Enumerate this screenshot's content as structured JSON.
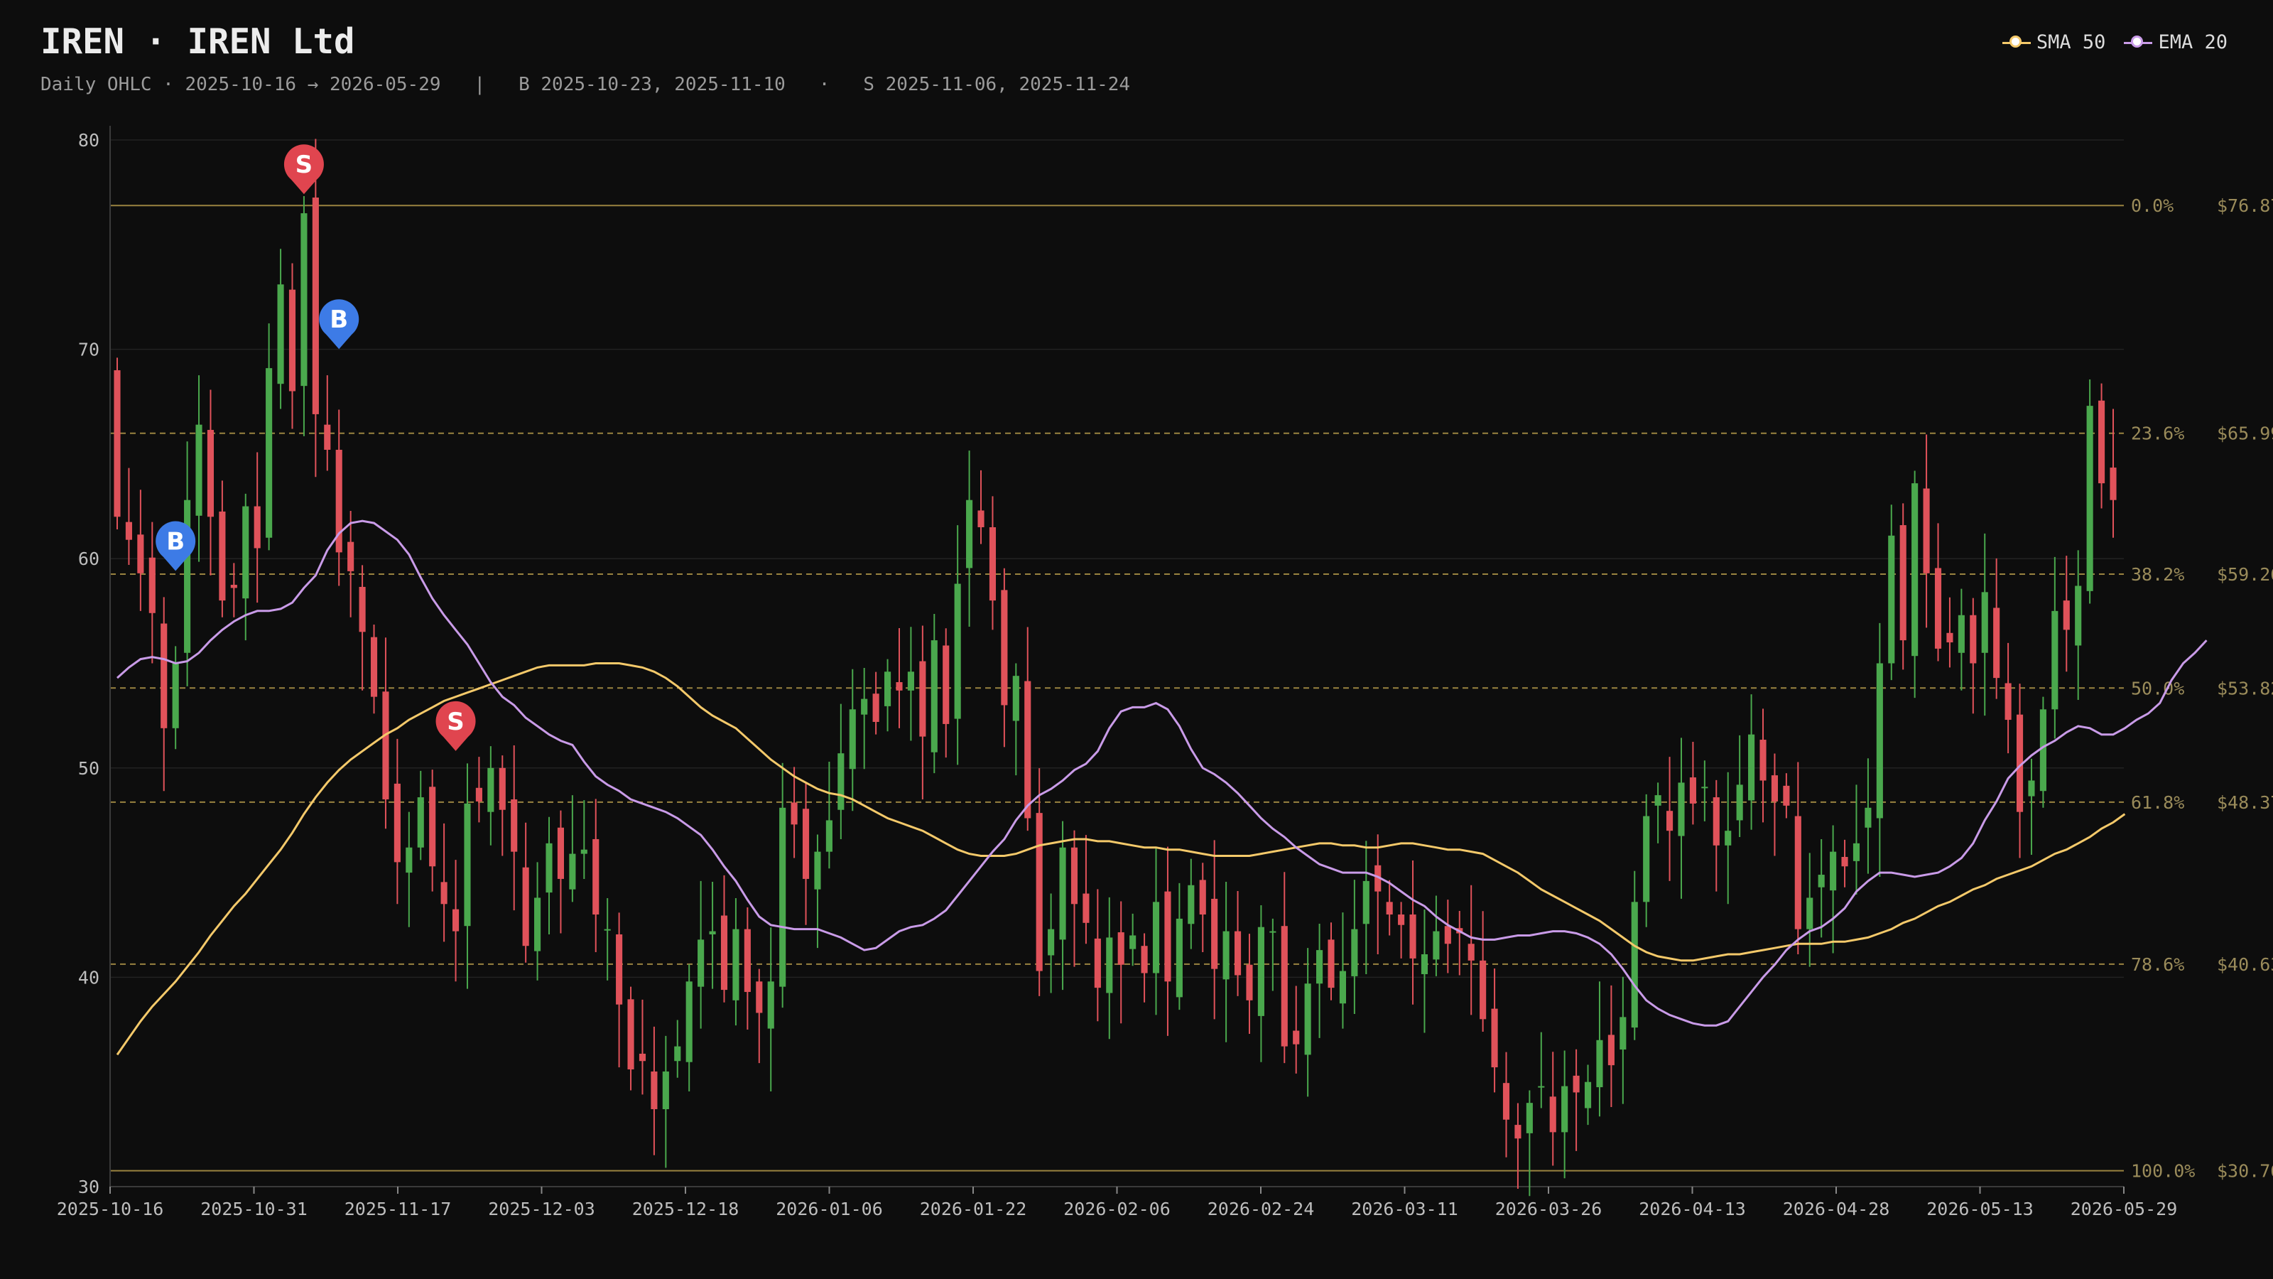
{
  "header": {
    "title": "IREN · IREN Ltd",
    "subtitle": "Daily OHLC · 2025-10-16 → 2026-05-29   |   B 2025-10-23, 2025-11-10   ·   S 2025-11-06, 2025-11-24"
  },
  "legend": [
    {
      "name": "SMA 50",
      "color": "#f4c96a"
    },
    {
      "name": "EMA 20",
      "color": "#c99be8"
    }
  ],
  "colors": {
    "up": "#4aa84d",
    "down": "#e0525a",
    "fib": "#9a8340",
    "fib_label": "#9a8b5a",
    "grid": "#222222",
    "axis_text": "#bdbdbd",
    "buy_marker": "#3d7be6",
    "sell_marker": "#e0454f"
  },
  "chart_data": {
    "type": "candlestick",
    "ylim": [
      30,
      80
    ],
    "y_ticks": [
      30,
      40,
      50,
      60,
      70,
      80
    ],
    "x_range": [
      "2025-10-16",
      "2026-05-29"
    ],
    "x_tick_labels": [
      "2025-10-16",
      "2025-10-31",
      "2025-11-17",
      "2025-12-03",
      "2025-12-18",
      "2026-01-06",
      "2026-01-22",
      "2026-02-06",
      "2026-02-24",
      "2026-03-11",
      "2026-03-26",
      "2026-04-13",
      "2026-04-28",
      "2026-05-13",
      "2026-05-29"
    ],
    "fibonacci": [
      {
        "level": "0.0%",
        "price": 76.87,
        "label": "$76.87"
      },
      {
        "level": "23.6%",
        "price": 65.99,
        "label": "$65.99"
      },
      {
        "level": "38.2%",
        "price": 59.26,
        "label": "$59.26"
      },
      {
        "level": "50.0%",
        "price": 53.82,
        "label": "$53.82"
      },
      {
        "level": "61.8%",
        "price": 48.37,
        "label": "$48.37"
      },
      {
        "level": "78.6%",
        "price": 40.63,
        "label": "$40.63"
      },
      {
        "level": "100.0%",
        "price": 30.76,
        "label": "$30.76"
      }
    ],
    "markers": [
      {
        "type": "B",
        "index": 5,
        "price": 60.6
      },
      {
        "type": "S",
        "index": 16,
        "price": 78.6
      },
      {
        "type": "B",
        "index": 19,
        "price": 71.2
      },
      {
        "type": "S",
        "index": 29,
        "price": 52.0
      }
    ],
    "closes": [
      62.0,
      60.9,
      59.3,
      57.4,
      51.9,
      55.0,
      62.8,
      66.4,
      62.0,
      58.0,
      58.6,
      62.5,
      60.5,
      69.1,
      73.1,
      68.0,
      76.5,
      66.9,
      65.2,
      60.3,
      59.4,
      56.5,
      53.4,
      48.5,
      45.5,
      46.2,
      48.6,
      45.3,
      43.5,
      42.2,
      48.3,
      48.4,
      50.0,
      48.0,
      46.0,
      41.5,
      43.8,
      46.4,
      44.7,
      45.9,
      46.1,
      43.0,
      42.3,
      38.7,
      35.6,
      36.0,
      33.7,
      35.5,
      36.7,
      39.8,
      41.8,
      42.2,
      39.4,
      42.3,
      39.3,
      38.3,
      39.8,
      48.1,
      47.3,
      44.7,
      46.0,
      47.5,
      50.7,
      52.8,
      53.3,
      52.2,
      54.6,
      53.7,
      54.6,
      51.5,
      56.1,
      52.1,
      58.8,
      62.8,
      61.5,
      58.0,
      53.0,
      54.4,
      47.6,
      40.3,
      42.3,
      46.2,
      43.5,
      42.6,
      39.5,
      41.9,
      40.6,
      42.0,
      40.2,
      43.6,
      39.8,
      42.8,
      44.4,
      43.0,
      40.4,
      42.2,
      40.1,
      38.9,
      42.4,
      42.2,
      36.7,
      36.8,
      39.7,
      41.3,
      39.5,
      40.3,
      42.3,
      44.6,
      44.1,
      43.0,
      42.5,
      40.9,
      41.1,
      42.2,
      41.6,
      42.1,
      40.8,
      38.0,
      35.7,
      33.2,
      32.3,
      34.0,
      34.8,
      32.6,
      34.8,
      34.5,
      35.0,
      37.0,
      35.8,
      38.1,
      43.6,
      47.7,
      48.7,
      47.0,
      49.3,
      48.3,
      49.1,
      46.3,
      47.0,
      49.2,
      51.6,
      49.4,
      48.4,
      48.2,
      42.3,
      43.8,
      44.9,
      46.0,
      45.3,
      46.4,
      48.1,
      55.0,
      61.1,
      56.1,
      63.6,
      59.3,
      55.7,
      56.0,
      57.3,
      55.0,
      58.4,
      54.3,
      52.3,
      47.9,
      49.4,
      52.8,
      57.5,
      56.6,
      58.7,
      67.3,
      63.6,
      62.8
    ],
    "sma50": [
      36.3,
      37.1,
      37.9,
      38.6,
      39.2,
      39.8,
      40.5,
      41.2,
      42.0,
      42.7,
      43.4,
      44.0,
      44.7,
      45.4,
      46.1,
      46.9,
      47.8,
      48.6,
      49.3,
      49.9,
      50.4,
      50.8,
      51.2,
      51.6,
      51.9,
      52.3,
      52.6,
      52.9,
      53.2,
      53.4,
      53.6,
      53.8,
      54.0,
      54.2,
      54.4,
      54.6,
      54.8,
      54.9,
      54.9,
      54.9,
      54.9,
      55.0,
      55.0,
      55.0,
      54.9,
      54.8,
      54.6,
      54.3,
      53.9,
      53.4,
      52.9,
      52.5,
      52.2,
      51.9,
      51.4,
      50.9,
      50.4,
      50.0,
      49.6,
      49.3,
      49.0,
      48.8,
      48.7,
      48.5,
      48.2,
      47.9,
      47.6,
      47.4,
      47.2,
      47.0,
      46.7,
      46.4,
      46.1,
      45.9,
      45.8,
      45.8,
      45.8,
      45.9,
      46.1,
      46.3,
      46.4,
      46.5,
      46.6,
      46.6,
      46.5,
      46.5,
      46.4,
      46.3,
      46.2,
      46.2,
      46.1,
      46.1,
      46.0,
      45.9,
      45.8,
      45.8,
      45.8,
      45.8,
      45.9,
      46.0,
      46.1,
      46.2,
      46.3,
      46.4,
      46.4,
      46.3,
      46.3,
      46.2,
      46.2,
      46.3,
      46.4,
      46.4,
      46.3,
      46.2,
      46.1,
      46.1,
      46.0,
      45.9,
      45.6,
      45.3,
      45.0,
      44.6,
      44.2,
      43.9,
      43.6,
      43.3,
      43.0,
      42.7,
      42.3,
      41.9,
      41.5,
      41.2,
      41.0,
      40.9,
      40.8,
      40.8,
      40.9,
      41.0,
      41.1,
      41.1,
      41.2,
      41.3,
      41.4,
      41.5,
      41.6,
      41.6,
      41.6,
      41.7,
      41.7,
      41.8,
      41.9,
      42.1,
      42.3,
      42.6,
      42.8,
      43.1,
      43.4,
      43.6,
      43.9,
      44.2,
      44.4,
      44.7,
      44.9,
      45.1,
      45.3,
      45.6,
      45.9,
      46.1,
      46.4,
      46.7,
      47.1,
      47.4,
      47.8
    ],
    "ema20": [
      54.3,
      54.8,
      55.2,
      55.3,
      55.2,
      55.0,
      55.1,
      55.5,
      56.1,
      56.6,
      57.0,
      57.3,
      57.5,
      57.5,
      57.6,
      57.9,
      58.6,
      59.2,
      60.4,
      61.2,
      61.7,
      61.8,
      61.7,
      61.3,
      60.9,
      60.2,
      59.1,
      58.1,
      57.3,
      56.6,
      55.9,
      55.0,
      54.1,
      53.4,
      53.0,
      52.4,
      52.0,
      51.6,
      51.3,
      51.1,
      50.3,
      49.6,
      49.2,
      48.9,
      48.5,
      48.3,
      48.1,
      47.9,
      47.6,
      47.2,
      46.8,
      46.1,
      45.3,
      44.6,
      43.7,
      42.9,
      42.5,
      42.4,
      42.3,
      42.3,
      42.3,
      42.1,
      41.9,
      41.6,
      41.3,
      41.4,
      41.8,
      42.2,
      42.4,
      42.5,
      42.8,
      43.2,
      43.9,
      44.6,
      45.3,
      46.0,
      46.6,
      47.5,
      48.2,
      48.7,
      49.0,
      49.4,
      49.9,
      50.2,
      50.8,
      51.9,
      52.7,
      52.9,
      52.9,
      53.1,
      52.8,
      52.0,
      50.9,
      50.0,
      49.7,
      49.3,
      48.8,
      48.2,
      47.6,
      47.1,
      46.7,
      46.2,
      45.8,
      45.4,
      45.2,
      45.0,
      45.0,
      45.0,
      44.8,
      44.5,
      44.1,
      43.7,
      43.4,
      42.9,
      42.5,
      42.2,
      41.9,
      41.8,
      41.8,
      41.9,
      42.0,
      42.0,
      42.1,
      42.2,
      42.2,
      42.1,
      41.9,
      41.6,
      41.1,
      40.4,
      39.6,
      38.9,
      38.5,
      38.2,
      38.0,
      37.8,
      37.7,
      37.7,
      37.9,
      38.6,
      39.3,
      40.0,
      40.6,
      41.3,
      41.8,
      42.2,
      42.4,
      42.8,
      43.3,
      44.1,
      44.6,
      45.0,
      45.0,
      44.9,
      44.8,
      44.9,
      45.0,
      45.3,
      45.7,
      46.4,
      47.5,
      48.4,
      49.5,
      50.1,
      50.6,
      51.0,
      51.3,
      51.7,
      52.0,
      51.9,
      51.6,
      51.6,
      51.9,
      52.3,
      52.6,
      53.1,
      54.2,
      55.0,
      55.5,
      56.1
    ]
  }
}
